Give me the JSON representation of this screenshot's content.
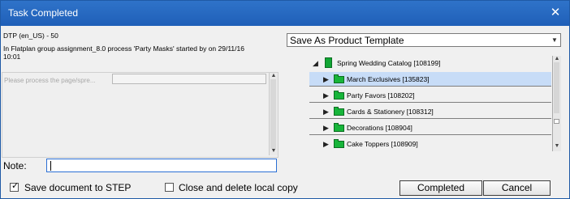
{
  "window": {
    "title": "Task Completed",
    "close_glyph": "✕"
  },
  "task": {
    "title": "DTP (en_US) - 50",
    "description": "In Flatplan group assignment_8.0 process 'Party Masks' started by  on 29/11/16 10:01"
  },
  "form": {
    "field_label": "Please process the page/spre...",
    "field_value": "",
    "note_label": "Note:",
    "note_value": ""
  },
  "template_select": {
    "value": "Save As Product Template"
  },
  "tree": {
    "root": {
      "label": "Spring Wedding Catalog [108199]",
      "icon": "book-icon",
      "expanded": true
    },
    "items": [
      {
        "label": "March Exclusives [135823]",
        "selected": true,
        "icon": "folder-icon"
      },
      {
        "label": "Party Favors [108202]",
        "selected": false,
        "icon": "folder-icon"
      },
      {
        "label": "Cards & Stationery [108312]",
        "selected": false,
        "icon": "folder-icon"
      },
      {
        "label": "Decorations [108904]",
        "selected": false,
        "icon": "folder-icon"
      },
      {
        "label": "Cake Toppers [108909]",
        "selected": false,
        "icon": "folder-icon"
      }
    ]
  },
  "options": {
    "save_to_step": {
      "label": "Save document to STEP",
      "checked": true
    },
    "close_delete": {
      "label": "Close and delete local copy",
      "checked": false
    }
  },
  "buttons": {
    "completed": "Completed",
    "cancel": "Cancel"
  },
  "colors": {
    "titlebar": "#1f5fb8",
    "selection": "#c7dcf7",
    "folder": "#17b53a"
  }
}
